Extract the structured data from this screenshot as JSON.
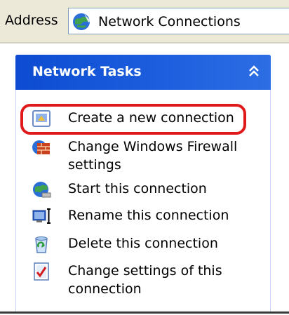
{
  "address_bar": {
    "label": "Address",
    "value": "Network Connections",
    "icon": "network-globe-icon"
  },
  "task_pane": {
    "title": "Network Tasks",
    "collapse_icon": "double-chevron-up-icon",
    "tasks": [
      {
        "label": "Create a new connection",
        "icon": "new-connection-wizard-icon",
        "highlighted": true
      },
      {
        "label": "Change Windows Firewall settings",
        "icon": "firewall-brick-icon"
      },
      {
        "label": "Start this connection",
        "icon": "globe-connect-icon"
      },
      {
        "label": "Rename this connection",
        "icon": "rename-computer-icon"
      },
      {
        "label": "Delete this connection",
        "icon": "recycle-bin-icon"
      },
      {
        "label": "Change settings of this connection",
        "icon": "settings-checklist-icon"
      }
    ]
  },
  "colors": {
    "header_blue": "#0d4cd2",
    "highlight_red": "#e01a1a"
  }
}
